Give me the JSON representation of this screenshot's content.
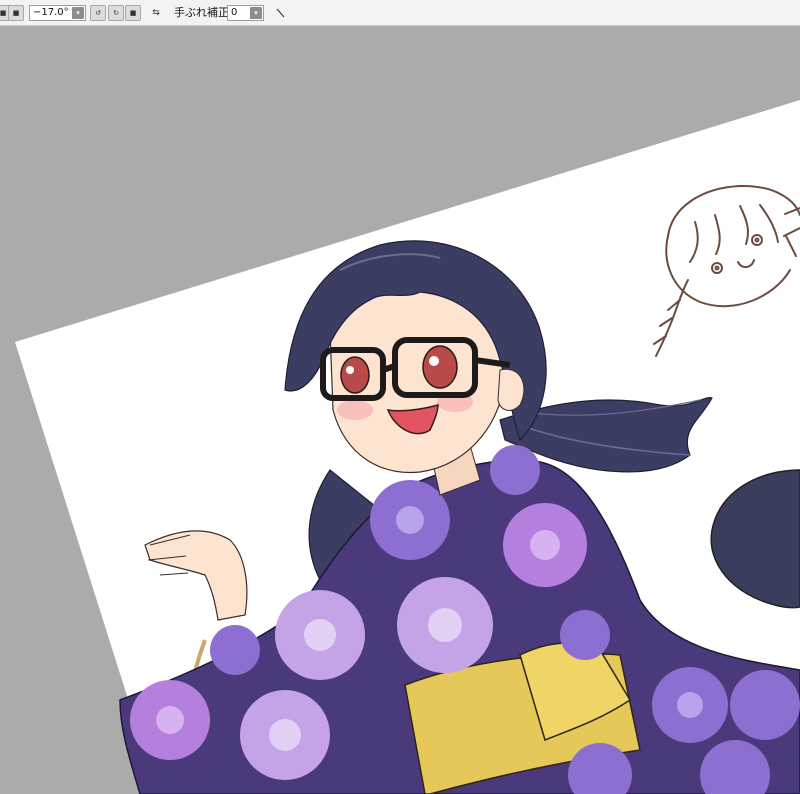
{
  "toolbar": {
    "rotation_value": "−17.0°",
    "stabilizer_label": "手ぶれ補正",
    "stabilizer_value": "0"
  },
  "colors": {
    "canvas_bg": "#ababab",
    "paper": "#ffffff",
    "hair": "#3c3d63",
    "yukata": "#4a3a7c",
    "obi": "#e6c85a",
    "skin": "#fde4d0",
    "eyes": "#b84a4a",
    "sketch_line": "#6b4c3e"
  },
  "icons": [
    "dropdown-arrow-icon",
    "rotate-left-icon",
    "rotate-right-icon",
    "reset-rotation-icon",
    "flip-icon",
    "line-tool-icon"
  ]
}
